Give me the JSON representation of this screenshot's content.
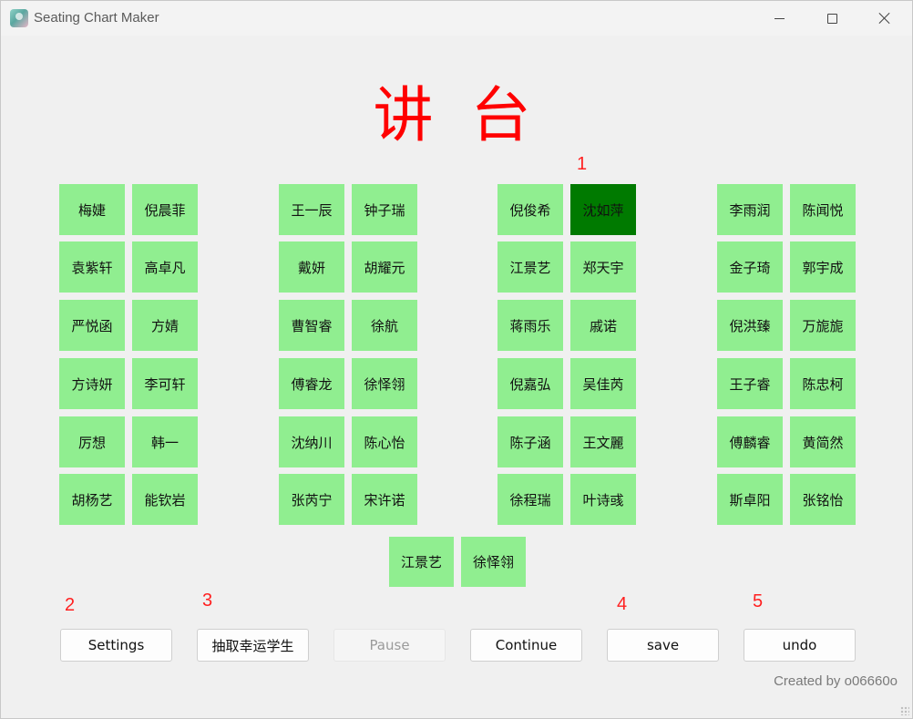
{
  "window": {
    "title": "Seating Chart Maker"
  },
  "podium_label": "讲 台",
  "annotations": [
    "1",
    "2",
    "3",
    "4",
    "5"
  ],
  "groups": [
    {
      "rows": [
        [
          "梅婕",
          "倪晨菲"
        ],
        [
          "袁紫轩",
          "高卓凡"
        ],
        [
          "严悦函",
          "方婧"
        ],
        [
          "方诗妍",
          "李可轩"
        ],
        [
          "厉想",
          "韩一"
        ],
        [
          "胡杨艺",
          "能钦岩"
        ]
      ]
    },
    {
      "rows": [
        [
          "王一辰",
          "钟子瑞"
        ],
        [
          "戴妍",
          "胡耀元"
        ],
        [
          "曹智睿",
          "徐航"
        ],
        [
          "傅睿龙",
          "徐怿翎"
        ],
        [
          "沈纳川",
          "陈心怡"
        ],
        [
          "张芮宁",
          "宋许诺"
        ]
      ]
    },
    {
      "rows": [
        [
          "倪俊希",
          "沈如萍"
        ],
        [
          "江景艺",
          "郑天宇"
        ],
        [
          "蒋雨乐",
          "戚诺"
        ],
        [
          "倪嘉弘",
          "吴佳芮"
        ],
        [
          "陈子涵",
          "王文麗"
        ],
        [
          "徐程瑞",
          "叶诗彧"
        ]
      ]
    },
    {
      "rows": [
        [
          "李雨润",
          "陈闻悦"
        ],
        [
          "金子琦",
          "郭宇成"
        ],
        [
          "倪洪臻",
          "万旎旎"
        ],
        [
          "王子睿",
          "陈忠柯"
        ],
        [
          "傅麟睿",
          "黄简然"
        ],
        [
          "斯卓阳",
          "张铭怡"
        ]
      ]
    }
  ],
  "extra_row": [
    "江景艺",
    "徐怿翎"
  ],
  "active_seat": "沈如萍",
  "buttons": {
    "settings": "Settings",
    "draw": "抽取幸运学生",
    "pause": "Pause",
    "continue": "Continue",
    "save": "save",
    "undo": "undo"
  },
  "footer": {
    "credit": "Created by o06660o"
  },
  "colors": {
    "seat": "#90ee90",
    "seat_active": "#007a00",
    "podium": "#ff0000",
    "annotation": "#ff2020"
  }
}
